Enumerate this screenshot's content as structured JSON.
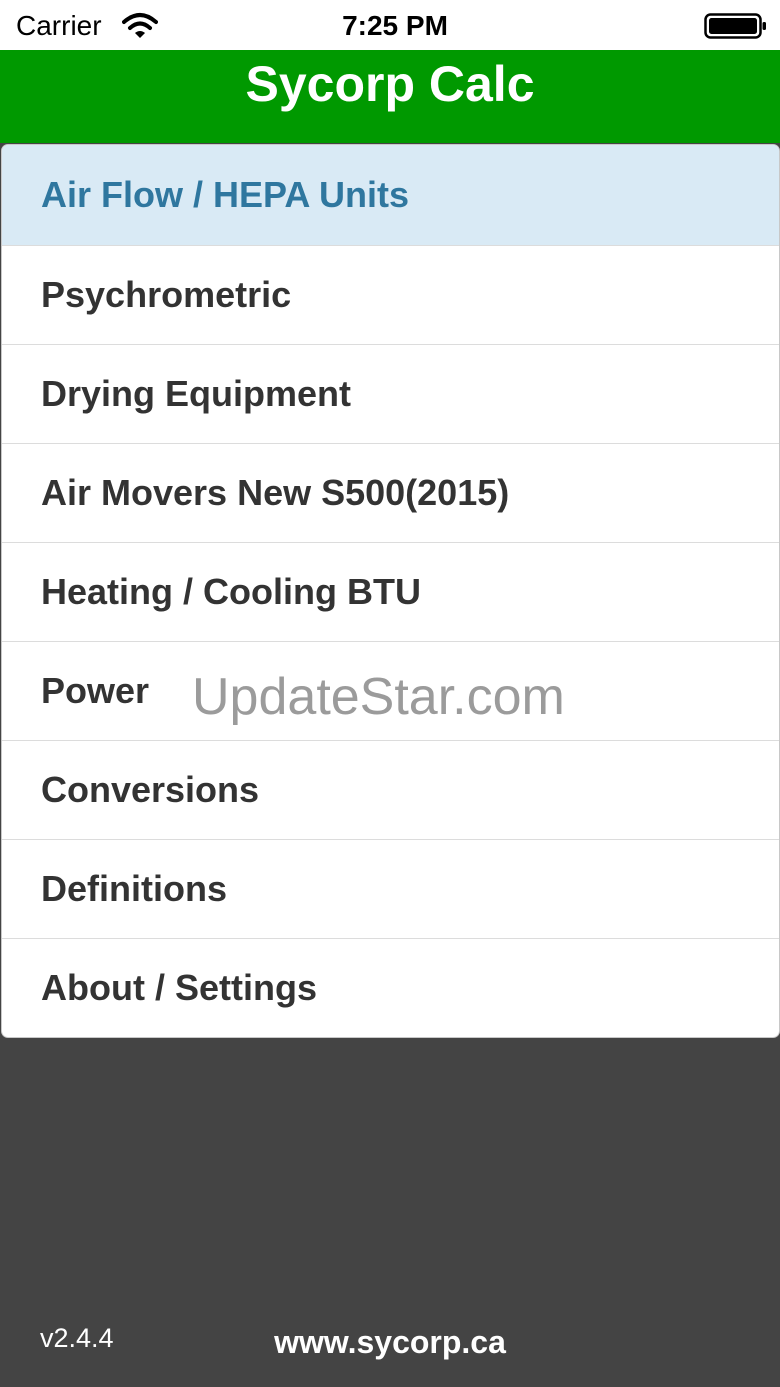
{
  "status_bar": {
    "carrier": "Carrier",
    "time": "7:25 PM",
    "wifi_icon": "wifi-icon",
    "battery_icon": "battery-icon"
  },
  "header": {
    "title": "Sycorp Calc",
    "color": "#009900"
  },
  "menu": {
    "items": [
      {
        "label": "Air Flow / HEPA Units",
        "selected": true
      },
      {
        "label": "Psychrometric"
      },
      {
        "label": "Drying Equipment"
      },
      {
        "label": "Air Movers New S500(2015)"
      },
      {
        "label": "Heating / Cooling BTU"
      },
      {
        "label": "Power"
      },
      {
        "label": "Conversions"
      },
      {
        "label": "Definitions"
      },
      {
        "label": "About / Settings"
      }
    ]
  },
  "watermark": "UpdateStar.com",
  "footer": {
    "version": "v2.4.4",
    "website": "www.sycorp.ca"
  },
  "colors": {
    "accent_green": "#009900",
    "selected_row_bg": "#d9eaf5",
    "selected_row_text": "#2f779f",
    "footer_bg": "#444444"
  }
}
